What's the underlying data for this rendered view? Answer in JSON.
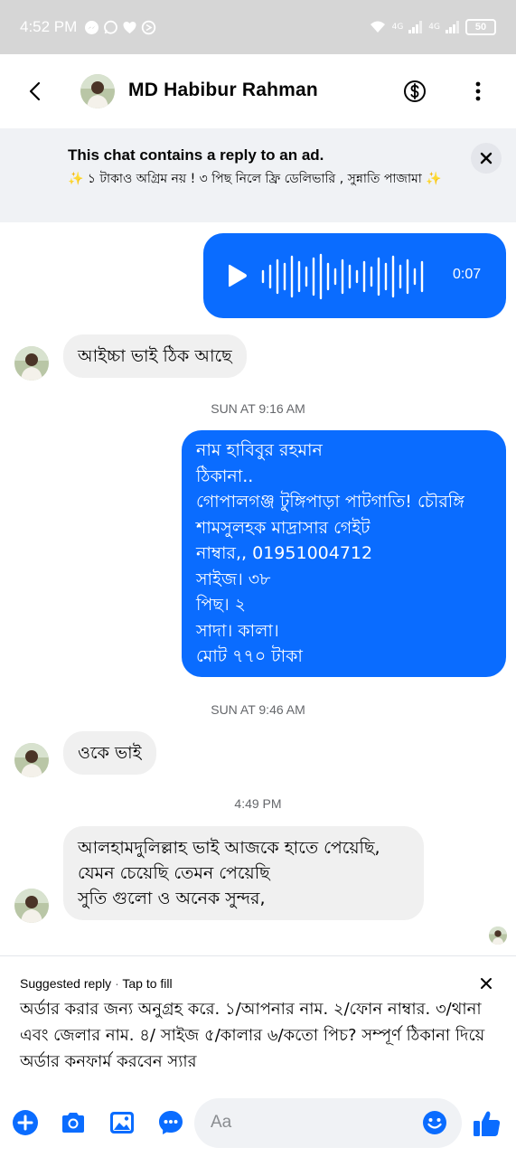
{
  "status_bar": {
    "time": "4:52 PM",
    "network_1": "4G",
    "network_2": "4G",
    "battery": "50"
  },
  "header": {
    "contact_name": "MD Habibur Rahman"
  },
  "ad_banner": {
    "title": "This chat contains a reply to an ad.",
    "text": "✨ ১ টাকাও অগ্রিম নয় ! ৩ পিছ নিলে ফ্রি ডেলিভারি , সুন্নাতি পাজামা ✨"
  },
  "messages": {
    "voice_duration": "0:07",
    "msg1": "আইচ্চা ভাই ঠিক আছে",
    "time1": "SUN AT 9:16 AM",
    "msg2_lines": [
      "নাম  হাবিবুর রহমান",
      "ঠিকানা..",
      "গোপালগঞ্জ টুঙ্গিপাড়া পাটগাতি! চৌরঙ্গি",
      "শামসুলহক মাদ্রাসার গেইট",
      "নাম্বার,, 01951004712",
      "সাইজ। ৩৮",
      "পিছ।  ২",
      "সাদা। কালা।",
      "মোট ৭৭০ টাকা"
    ],
    "time2": "SUN AT 9:46 AM",
    "msg3": "ওকে ভাই",
    "time3": "4:49 PM",
    "msg4_lines": [
      "আলহামদুলিল্লাহ ভাই আজকে হাতে পেয়েছি,",
      "যেমন চেয়েছি তেমন পেয়েছি",
      "সুতি গুলো ও অনেক সুন্দর,"
    ]
  },
  "suggested_reply": {
    "label": "Suggested reply",
    "separator": "·",
    "hint": "Tap to fill",
    "text": "অর্ডার করার জন্য অনুগ্রহ করে. ১/আপনার নাম. ২/ফোন নাম্বার. ৩/থানা এবং জেলার নাম. ৪/ সাইজ ৫/কালার ৬/কতো পিচ? সম্পূর্ণ ঠিকানা দিয়ে অর্ডার কনফার্ম করবেন স্যার"
  },
  "composer": {
    "placeholder": "Aa"
  },
  "colors": {
    "accent": "#0a6cff",
    "incoming_bubble": "#f0f0f0",
    "status_bar": "#d6d6d6"
  },
  "icons": [
    "back-arrow-icon",
    "dollar-icon",
    "more-vertical-icon",
    "close-icon",
    "play-icon",
    "plus-icon",
    "camera-icon",
    "image-icon",
    "chat-bubble-icon",
    "emoji-icon",
    "thumbs-up-icon"
  ]
}
